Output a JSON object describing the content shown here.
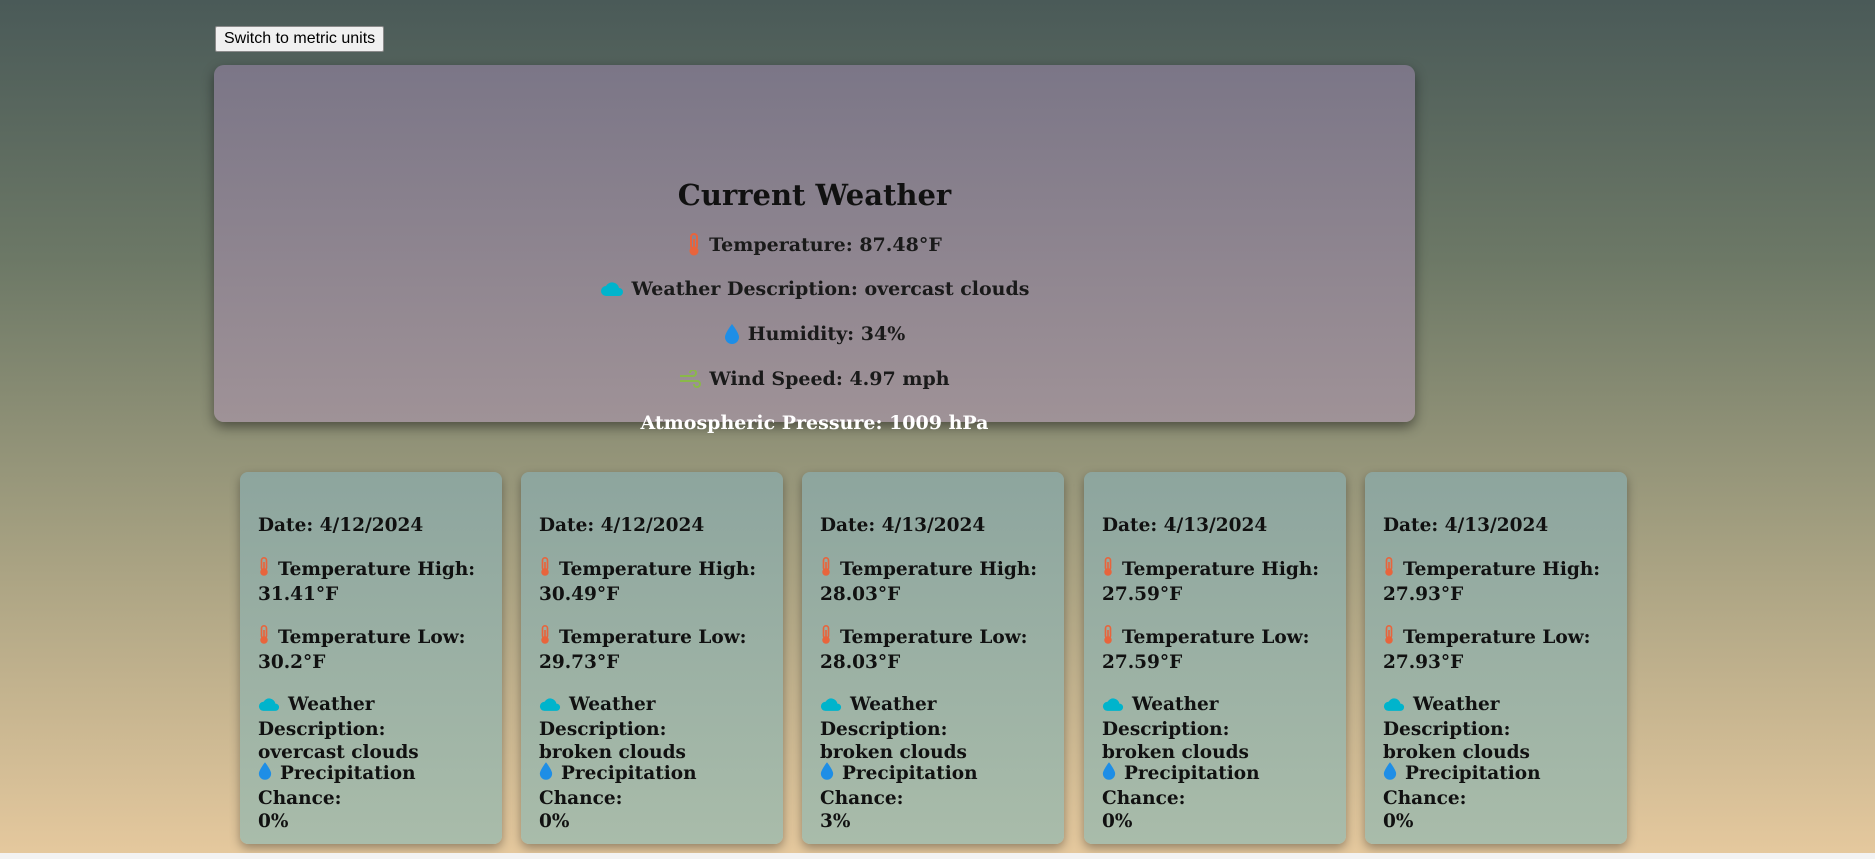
{
  "toolbar": {
    "unit_toggle_label": "Switch to metric units"
  },
  "current": {
    "title": "Current Weather",
    "temperature": "Temperature: 87.48°F",
    "description": "Weather Description: overcast clouds",
    "humidity": "Humidity: 34%",
    "wind": "Wind Speed: 4.97 mph",
    "pressure": "Atmospheric Pressure: 1009 hPa"
  },
  "forecast": [
    {
      "date": "Date: 4/12/2024",
      "high_label": "Temperature High:",
      "high": "31.41°F",
      "low_label": "Temperature Low:",
      "low": "30.2°F",
      "desc_label": "Weather Description:",
      "desc": "overcast clouds",
      "precip_label": "Precipitation Chance:",
      "precip": "0%"
    },
    {
      "date": "Date: 4/12/2024",
      "high_label": "Temperature High:",
      "high": "30.49°F",
      "low_label": "Temperature Low:",
      "low": "29.73°F",
      "desc_label": "Weather Description:",
      "desc": "broken clouds",
      "precip_label": "Precipitation Chance:",
      "precip": "0%"
    },
    {
      "date": "Date: 4/13/2024",
      "high_label": "Temperature High:",
      "high": "28.03°F",
      "low_label": "Temperature Low:",
      "low": "28.03°F",
      "desc_label": "Weather Description:",
      "desc": "broken clouds",
      "precip_label": "Precipitation Chance:",
      "precip": "3%"
    },
    {
      "date": "Date: 4/13/2024",
      "high_label": "Temperature High:",
      "high": "27.59°F",
      "low_label": "Temperature Low:",
      "low": "27.59°F",
      "desc_label": "Weather Description:",
      "desc": "broken clouds",
      "precip_label": "Precipitation Chance:",
      "precip": "0%"
    },
    {
      "date": "Date: 4/13/2024",
      "high_label": "Temperature High:",
      "high": "27.93°F",
      "low_label": "Temperature Low:",
      "low": "27.93°F",
      "desc_label": "Weather Description:",
      "desc": "broken clouds",
      "precip_label": "Precipitation Chance:",
      "precip": "0%"
    }
  ],
  "icons": {
    "temperature": "thermometer-icon",
    "description": "cloud-icon",
    "humidity": "droplet-icon",
    "wind": "wind-icon"
  },
  "colors": {
    "thermometer": "#e8643c",
    "cloud": "#00b4cc",
    "droplet": "#1e8ee6",
    "wind": "#8ab84a"
  }
}
